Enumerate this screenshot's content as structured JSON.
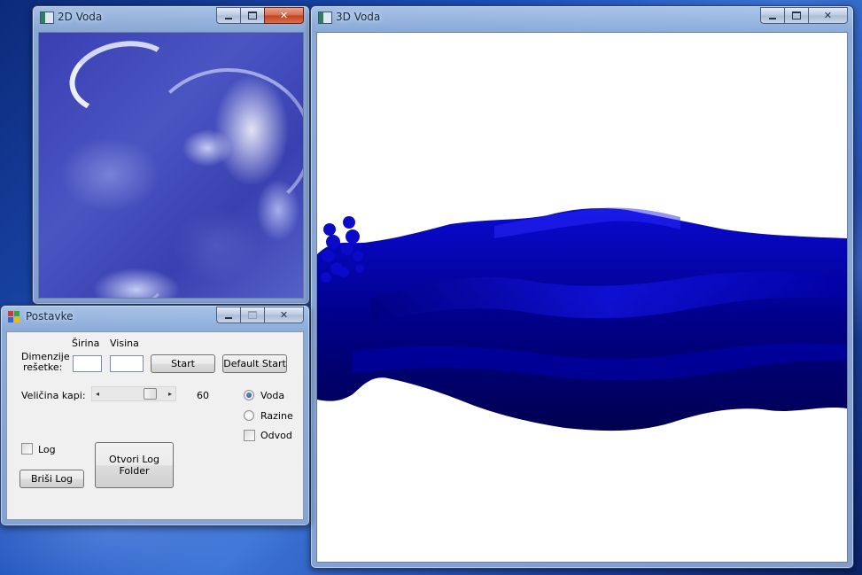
{
  "window_2d": {
    "title": "2D Voda"
  },
  "window_3d": {
    "title": "3D Voda"
  },
  "settings": {
    "title": "Postavke",
    "col_width_label": "Širina",
    "col_height_label": "Visina",
    "grid_label_line1": "Dimenzije",
    "grid_label_line2": "rešetke:",
    "width_value": "",
    "height_value": "",
    "start_button": "Start",
    "default_start_button": "Default Start",
    "drop_size_label": "Veličina kapi:",
    "drop_size_value": "60",
    "drop_size_fraction": 0.82,
    "radio_water": "Voda",
    "radio_levels": "Razine",
    "checkbox_drain": "Odvod",
    "checkbox_log": "Log",
    "open_log_button_line1": "Otvori Log",
    "open_log_button_line2": "Folder",
    "delete_log_button": "Briši Log",
    "selected_radio": "Voda"
  },
  "colors": {
    "water_dark": "#000060",
    "water_mid": "#0000b8",
    "water_bright": "#1818ff",
    "close_red": "#c2411d"
  },
  "icons": [
    "minimize-icon",
    "maximize-icon",
    "close-icon",
    "window-app-icon"
  ]
}
